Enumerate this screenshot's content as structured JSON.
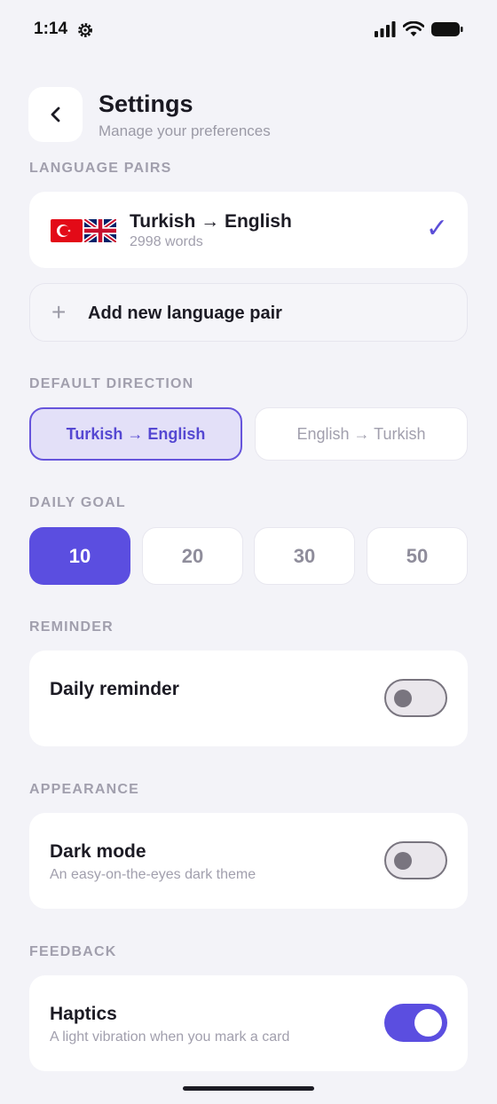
{
  "status_bar": {
    "time": "1:14"
  },
  "header": {
    "title": "Settings",
    "subtitle": "Manage your preferences"
  },
  "sections": {
    "language_pairs": "LANGUAGE PAIRS",
    "default_direction": "DEFAULT DIRECTION",
    "daily_goal": "DAILY GOAL",
    "reminder": "REMINDER",
    "appearance": "APPEARANCE",
    "feedback": "FEEDBACK"
  },
  "language_pair": {
    "name": "Turkish → English",
    "word_count": "2998 words",
    "selected": true
  },
  "add_pair": {
    "label": "Add new language pair"
  },
  "direction": {
    "options": [
      "Turkish → English",
      "English → Turkish"
    ],
    "selected": "Turkish → English"
  },
  "daily_goal": {
    "options": [
      "10",
      "20",
      "30",
      "50"
    ],
    "selected": "10"
  },
  "reminder": {
    "title": "Daily reminder",
    "enabled": false
  },
  "appearance": {
    "title": "Dark mode",
    "subtitle": "An easy-on-the-eyes dark theme",
    "enabled": false
  },
  "feedback": {
    "title": "Haptics",
    "subtitle": "A light vibration when you mark a card",
    "enabled": true
  },
  "colors": {
    "accent": "#5b4ee0",
    "background": "#f3f3f8",
    "muted": "#a19fad"
  },
  "icons": {
    "status_gear": "gear-icon",
    "back": "chevron-left-icon",
    "check": "checkmark-icon",
    "add": "plus-icon",
    "flag_tr": "turkey-flag-icon",
    "flag_gb": "uk-flag-icon"
  }
}
